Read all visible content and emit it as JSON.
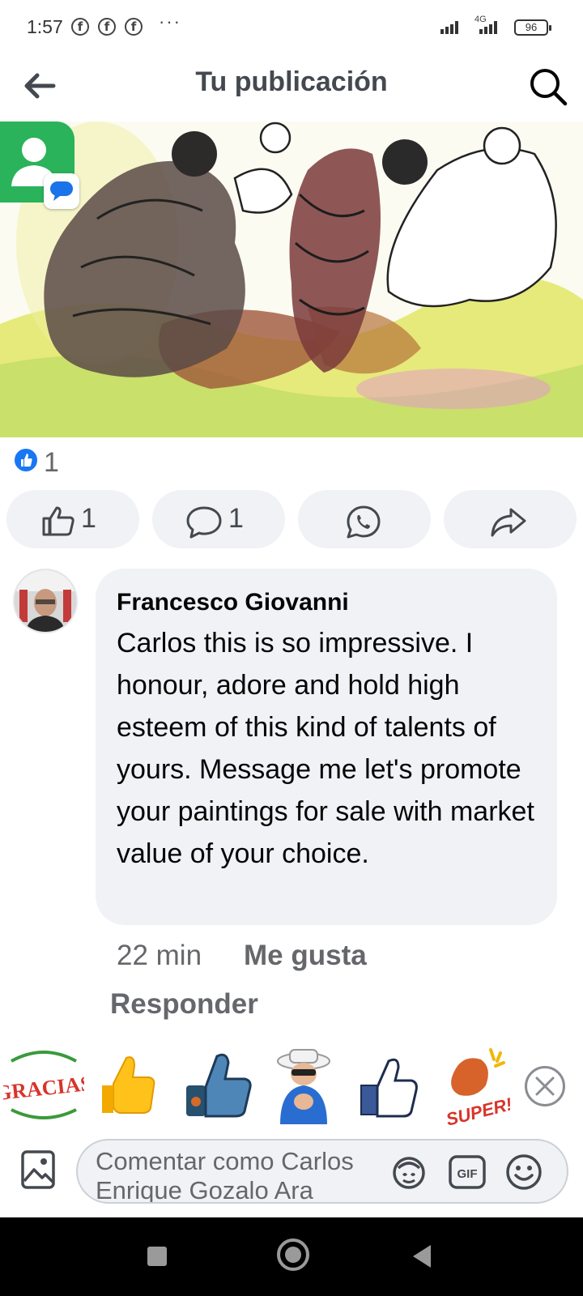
{
  "status_bar": {
    "time": "1:57",
    "notification_glyph": "f",
    "more": "···",
    "network": "4G",
    "battery": "96"
  },
  "header": {
    "title": "Tu publicación",
    "back_icon": "arrow-left-icon",
    "search_icon": "search-icon"
  },
  "post": {
    "reaction_count": "1",
    "actions": {
      "like_count": "1",
      "comment_count": "1"
    }
  },
  "comment": {
    "author": "Francesco Giovanni",
    "text": "Carlos this is so impressive. I honour, adore and hold high esteem of this kind of talents of yours. Message me let's promote your paintings for sale with market value of your choice.",
    "time": "22 min",
    "like_label": "Me gusta",
    "reply_label": "Responder"
  },
  "stickers": {
    "gracias_text": "GRACIAS",
    "super_text": "SUPER!"
  },
  "composer": {
    "placeholder": "Comentar como Carlos Enrique Gozalo Ara"
  },
  "colors": {
    "fb_blue": "#1877f2",
    "bubble_gray": "#f0f2f5",
    "secondary_text": "#65676b"
  }
}
